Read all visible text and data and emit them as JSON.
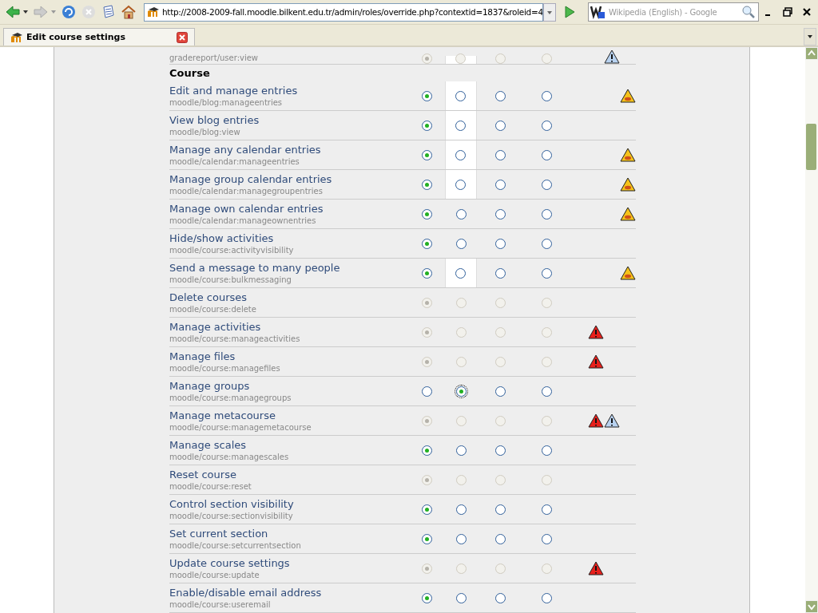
{
  "browser": {
    "url": "http://2008-2009-fall.moodle.bilkent.edu.tr/admin/roles/override.php?contextid=1837&roleid=4",
    "search_placeholder": "Wikipedia (English) - Google"
  },
  "tab": {
    "title": "Edit course settings"
  },
  "partial_row": {
    "capability": "gradereport/user:view",
    "disabled": true,
    "highlight": true,
    "options": [
      {
        "selected": true
      },
      {
        "selected": false
      },
      {
        "selected": false
      },
      {
        "selected": false
      }
    ],
    "risks": [
      {
        "kind": "personal"
      }
    ]
  },
  "section": "Course",
  "rows": [
    {
      "name": "Edit and manage entries",
      "capability": "moodle/blog:manageentries",
      "disabled": false,
      "highlight": true,
      "options": [
        {
          "selected": true
        },
        {
          "selected": false
        },
        {
          "selected": false
        },
        {
          "selected": false
        }
      ],
      "risks": [
        {
          "kind": "spam"
        }
      ]
    },
    {
      "name": "View blog entries",
      "capability": "moodle/blog:view",
      "disabled": false,
      "highlight": true,
      "options": [
        {
          "selected": true
        },
        {
          "selected": false
        },
        {
          "selected": false
        },
        {
          "selected": false
        }
      ],
      "risks": []
    },
    {
      "name": "Manage any calendar entries",
      "capability": "moodle/calendar:manageentries",
      "disabled": false,
      "highlight": true,
      "options": [
        {
          "selected": true
        },
        {
          "selected": false
        },
        {
          "selected": false
        },
        {
          "selected": false
        }
      ],
      "risks": [
        {
          "kind": "spam"
        }
      ]
    },
    {
      "name": "Manage group calendar entries",
      "capability": "moodle/calendar:managegroupentries",
      "disabled": false,
      "highlight": true,
      "options": [
        {
          "selected": true
        },
        {
          "selected": false
        },
        {
          "selected": false
        },
        {
          "selected": false
        }
      ],
      "risks": [
        {
          "kind": "spam"
        }
      ]
    },
    {
      "name": "Manage own calendar entries",
      "capability": "moodle/calendar:manageownentries",
      "disabled": false,
      "highlight": false,
      "options": [
        {
          "selected": true
        },
        {
          "selected": false
        },
        {
          "selected": false
        },
        {
          "selected": false
        }
      ],
      "risks": [
        {
          "kind": "spam"
        }
      ]
    },
    {
      "name": "Hide/show activities",
      "capability": "moodle/course:activityvisibility",
      "disabled": false,
      "highlight": false,
      "options": [
        {
          "selected": true
        },
        {
          "selected": false
        },
        {
          "selected": false
        },
        {
          "selected": false
        }
      ],
      "risks": []
    },
    {
      "name": "Send a message to many people",
      "capability": "moodle/course:bulkmessaging",
      "disabled": false,
      "highlight": true,
      "options": [
        {
          "selected": true
        },
        {
          "selected": false
        },
        {
          "selected": false
        },
        {
          "selected": false
        }
      ],
      "risks": [
        {
          "kind": "spam"
        }
      ]
    },
    {
      "name": "Delete courses",
      "capability": "moodle/course:delete",
      "disabled": true,
      "highlight": false,
      "options": [
        {
          "selected": true
        },
        {
          "selected": false
        },
        {
          "selected": false
        },
        {
          "selected": false
        }
      ],
      "risks": []
    },
    {
      "name": "Manage activities",
      "capability": "moodle/course:manageactivities",
      "disabled": true,
      "highlight": false,
      "options": [
        {
          "selected": true
        },
        {
          "selected": false
        },
        {
          "selected": false
        },
        {
          "selected": false
        }
      ],
      "risks": [
        {
          "kind": "config"
        }
      ]
    },
    {
      "name": "Manage files",
      "capability": "moodle/course:managefiles",
      "disabled": true,
      "highlight": false,
      "options": [
        {
          "selected": true
        },
        {
          "selected": false
        },
        {
          "selected": false
        },
        {
          "selected": false
        }
      ],
      "risks": [
        {
          "kind": "config"
        }
      ]
    },
    {
      "name": "Manage groups",
      "capability": "moodle/course:managegroups",
      "disabled": false,
      "highlight": false,
      "options": [
        {
          "selected": false
        },
        {
          "selected": true
        },
        {
          "selected": false
        },
        {
          "selected": false
        }
      ],
      "risks": []
    },
    {
      "name": "Manage metacourse",
      "capability": "moodle/course:managemetacourse",
      "disabled": true,
      "highlight": false,
      "options": [
        {
          "selected": true
        },
        {
          "selected": false
        },
        {
          "selected": false
        },
        {
          "selected": false
        }
      ],
      "risks": [
        {
          "kind": "config"
        },
        {
          "kind": "personal"
        }
      ]
    },
    {
      "name": "Manage scales",
      "capability": "moodle/course:managescales",
      "disabled": false,
      "highlight": false,
      "options": [
        {
          "selected": true
        },
        {
          "selected": false
        },
        {
          "selected": false
        },
        {
          "selected": false
        }
      ],
      "risks": []
    },
    {
      "name": "Reset course",
      "capability": "moodle/course:reset",
      "disabled": true,
      "highlight": false,
      "options": [
        {
          "selected": true
        },
        {
          "selected": false
        },
        {
          "selected": false
        },
        {
          "selected": false
        }
      ],
      "risks": []
    },
    {
      "name": "Control section visibility",
      "capability": "moodle/course:sectionvisibility",
      "disabled": false,
      "highlight": false,
      "options": [
        {
          "selected": true
        },
        {
          "selected": false
        },
        {
          "selected": false
        },
        {
          "selected": false
        }
      ],
      "risks": []
    },
    {
      "name": "Set current section",
      "capability": "moodle/course:setcurrentsection",
      "disabled": false,
      "highlight": false,
      "options": [
        {
          "selected": true
        },
        {
          "selected": false
        },
        {
          "selected": false
        },
        {
          "selected": false
        }
      ],
      "risks": []
    },
    {
      "name": "Update course settings",
      "capability": "moodle/course:update",
      "disabled": true,
      "highlight": false,
      "options": [
        {
          "selected": true
        },
        {
          "selected": false
        },
        {
          "selected": false
        },
        {
          "selected": false
        }
      ],
      "risks": [
        {
          "kind": "config"
        }
      ]
    },
    {
      "name": "Enable/disable email address",
      "capability": "moodle/course:useremail",
      "disabled": false,
      "highlight": false,
      "options": [
        {
          "selected": true
        },
        {
          "selected": false
        },
        {
          "selected": false
        },
        {
          "selected": false
        }
      ],
      "risks": []
    }
  ]
}
